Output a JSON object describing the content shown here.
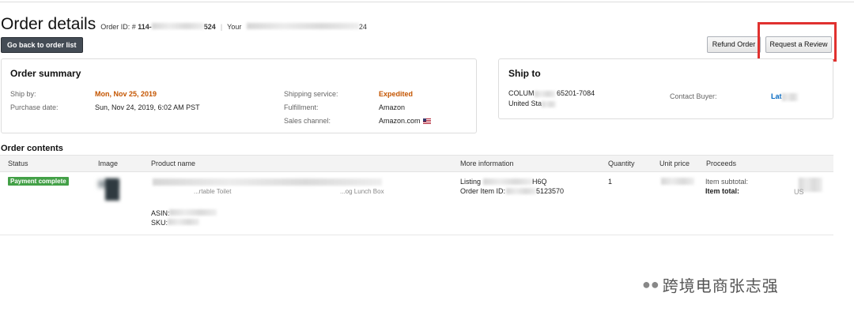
{
  "header": {
    "title": "Order details",
    "order_id_label": "Order ID: #",
    "order_id_prefix": "114-",
    "order_id_suffix": "524",
    "your_label": "Your",
    "your_suffix": "24"
  },
  "buttons": {
    "back": "Go back to order list",
    "refund": "Refund Order",
    "review": "Request a Review"
  },
  "order_summary": {
    "title": "Order summary",
    "ship_by_label": "Ship by:",
    "ship_by_value": "Mon, Nov 25, 2019",
    "purchase_date_label": "Purchase date:",
    "purchase_date_value": "Sun, Nov 24, 2019, 6:02 AM PST",
    "shipping_service_label": "Shipping service:",
    "shipping_service_value": "Expedited",
    "fulfillment_label": "Fulfillment:",
    "fulfillment_value": "Amazon",
    "sales_channel_label": "Sales channel:",
    "sales_channel_value": "Amazon.com"
  },
  "ship_to": {
    "title": "Ship to",
    "address_line1_start": "COLUM",
    "address_line1_end": "65201-7084",
    "address_line2": "United Sta",
    "contact_label": "Contact Buyer:",
    "contact_value": "Lat"
  },
  "contents": {
    "title": "Order contents",
    "columns": [
      "Status",
      "Image",
      "Product name",
      "More information",
      "Quantity",
      "Unit price",
      "Proceeds"
    ],
    "row": {
      "status": "Payment complete",
      "product_fragment1": "...rtable Toilet",
      "product_fragment2": "...og Lunch Box",
      "asin_label": "ASIN:",
      "sku_label": "SKU:",
      "listing_label": "Listing",
      "listing_suffix": "H6Q",
      "order_item_label": "Order Item ID:",
      "order_item_suffix": "5123570",
      "quantity": "1",
      "subtotal_label": "Item subtotal:",
      "total_label": "Item total:",
      "total_fragment": "US"
    }
  },
  "watermark": {
    "text": "跨境电商张志强"
  }
}
